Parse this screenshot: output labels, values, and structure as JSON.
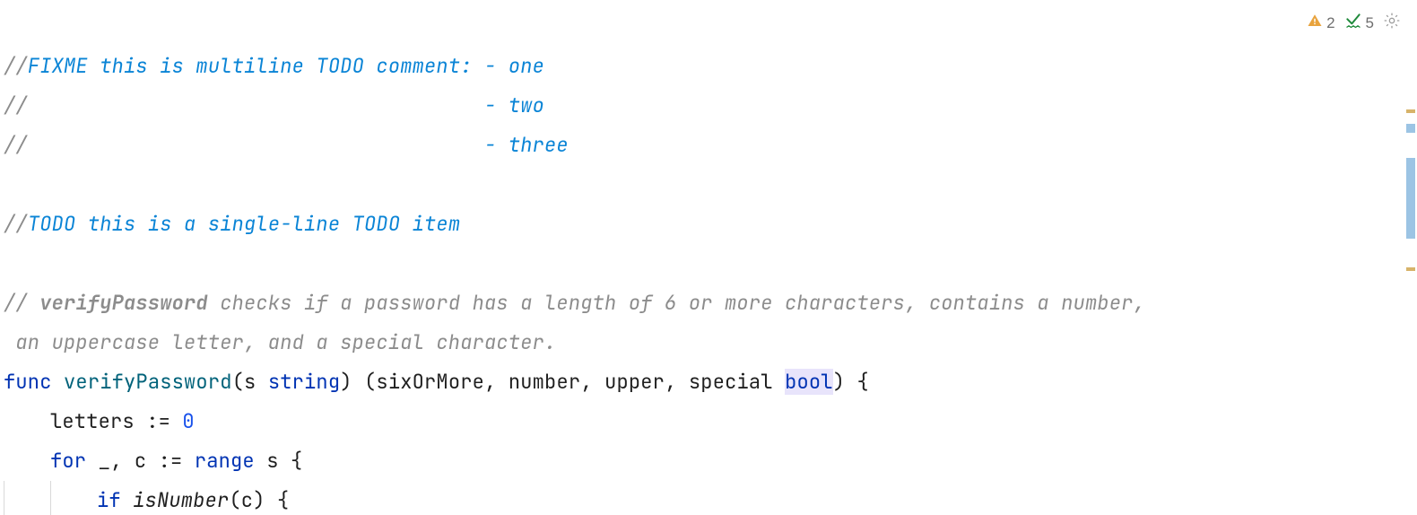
{
  "inspections": {
    "warnings": "2",
    "typos": "5"
  },
  "code": {
    "l1_slashes": "//",
    "l1_todo": "FIXME this is multiline TODO comment: - one",
    "l2_slashes": "//",
    "l2_todo": "                                      - two",
    "l3_slashes": "//",
    "l3_todo": "                                      - three",
    "l5_slashes": "//",
    "l5_todo": "TODO this is a single-line TODO item",
    "l7_slashes": "// ",
    "l7_fn": "verifyPassword",
    "l7_rest": " checks if a password has a length of 6 or more characters, contains a number,",
    "l8_doc": " an uppercase letter, and a special character.",
    "l9_func": "func ",
    "l9_name": "verifyPassword",
    "l9_p1": "(s ",
    "l9_type1": "string",
    "l9_p2": ") (sixOrMore",
    "l9_c1": ", ",
    "l9_r2": "number",
    "l9_c2": ", ",
    "l9_r3": "upper",
    "l9_c3": ", ",
    "l9_r4": "special ",
    "l9_bool": "bool",
    "l9_end": ") {",
    "l10_ident": "letters ",
    "l10_op": ":= ",
    "l10_num": "0",
    "l11_for": "for ",
    "l11_blank": "_",
    "l11_c": ", c ",
    "l11_op": ":= ",
    "l11_range": "range ",
    "l11_s": "s {",
    "l12_if": "if ",
    "l12_call": "isNumber",
    "l12_rest": "(c) {"
  }
}
